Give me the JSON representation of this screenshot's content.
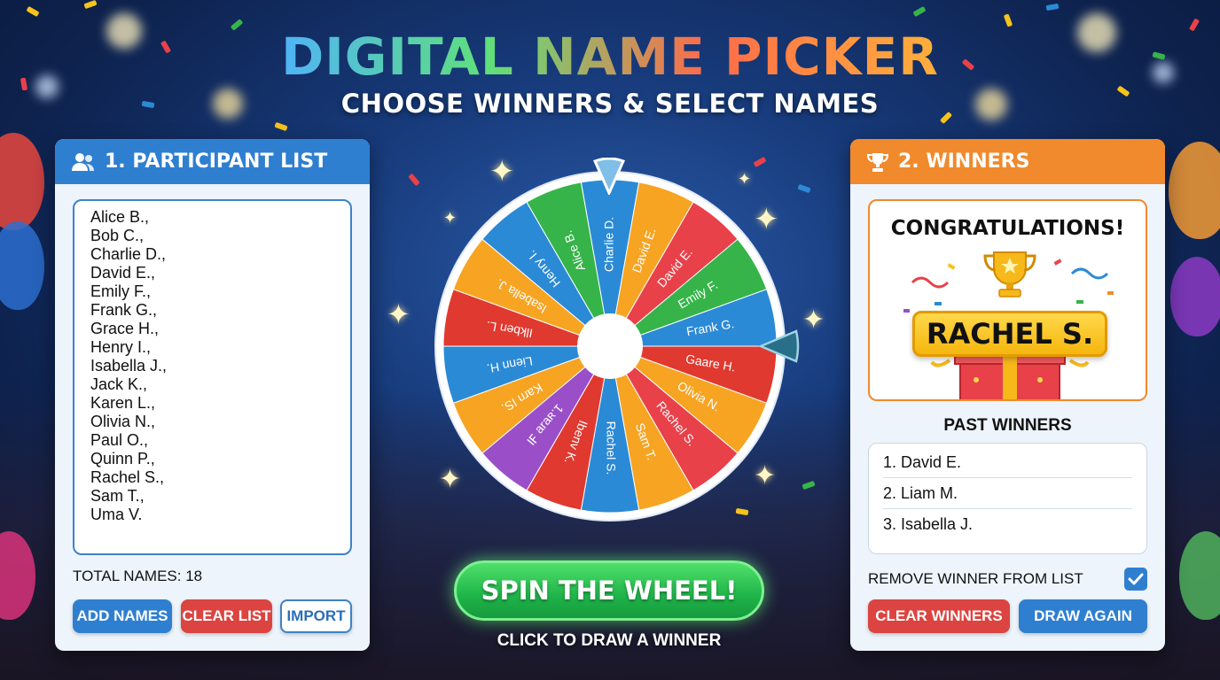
{
  "header": {
    "title": "DIGITAL NAME PICKER",
    "subtitle": "CHOOSE WINNERS & SELECT NAMES"
  },
  "participants_panel": {
    "heading": "1. PARTICIPANT LIST",
    "icon": "users-icon",
    "names": [
      "Alice B.,",
      "Bob C.,",
      "Charlie D.,",
      "David E.,",
      "Emily F.,",
      "Frank G.,",
      "Grace H.,",
      "Henry I.,",
      "Isabella J.,",
      "Jack K.,",
      "Karen L.,",
      "Olivia N.,",
      "Paul O.,",
      "Quinn P.,",
      "Rachel S.,",
      "Sam T.,",
      "Uma V."
    ],
    "total_label": "TOTAL NAMES: 18",
    "buttons": {
      "add": "ADD NAMES",
      "clear": "CLEAR LIST",
      "import": "IMPORT"
    }
  },
  "wheel": {
    "segments": [
      {
        "label": "Charlie D.",
        "color": "#2b8ad6"
      },
      {
        "label": "David E.",
        "color": "#f7a423"
      },
      {
        "label": "David E.",
        "color": "#e8414a"
      },
      {
        "label": "Emily F.",
        "color": "#36b449"
      },
      {
        "label": "Frank G.",
        "color": "#2b8ad6"
      },
      {
        "label": "Gaare H.",
        "color": "#e0392f"
      },
      {
        "label": "Olivia N.",
        "color": "#f7a423"
      },
      {
        "label": "Rachel S.",
        "color": "#e8414a"
      },
      {
        "label": "Sam T.",
        "color": "#f7a423"
      },
      {
        "label": "Rachel S.",
        "color": "#2b8ad6"
      },
      {
        "label": "Ibenv K.",
        "color": "#e0392f"
      },
      {
        "label": "1.ᴚɐɹɐ ℲI",
        "color": "#9a4fc9"
      },
      {
        "label": "Karn IS.",
        "color": "#f7a423"
      },
      {
        "label": "Lienn H.",
        "color": "#2b8ad6"
      },
      {
        "label": "Ilkben L.",
        "color": "#e0392f"
      },
      {
        "label": "Isabella J.",
        "color": "#f7a423"
      },
      {
        "label": "Henry I.",
        "color": "#2b8ad6"
      },
      {
        "label": "Alice B.",
        "color": "#36b449"
      }
    ],
    "pointer_color": "#7fbfe8",
    "side_pointer_color": "#2a6f8a"
  },
  "spin": {
    "button": "SPIN THE WHEEL!",
    "hint": "CLICK TO DRAW A WINNER"
  },
  "winners_panel": {
    "heading": "2. WINNERS",
    "icon": "trophy-icon",
    "congrats": "CONGRATULATIONS!",
    "winner": "RACHEL S.",
    "past_title": "PAST WINNERS",
    "past": [
      "1. David E.",
      "2. Liam M.",
      "3. Isabella J."
    ],
    "remove_label": "REMOVE WINNER FROM LIST",
    "remove_checked": true,
    "buttons": {
      "clear": "CLEAR WINNERS",
      "again": "DRAW AGAIN"
    }
  }
}
